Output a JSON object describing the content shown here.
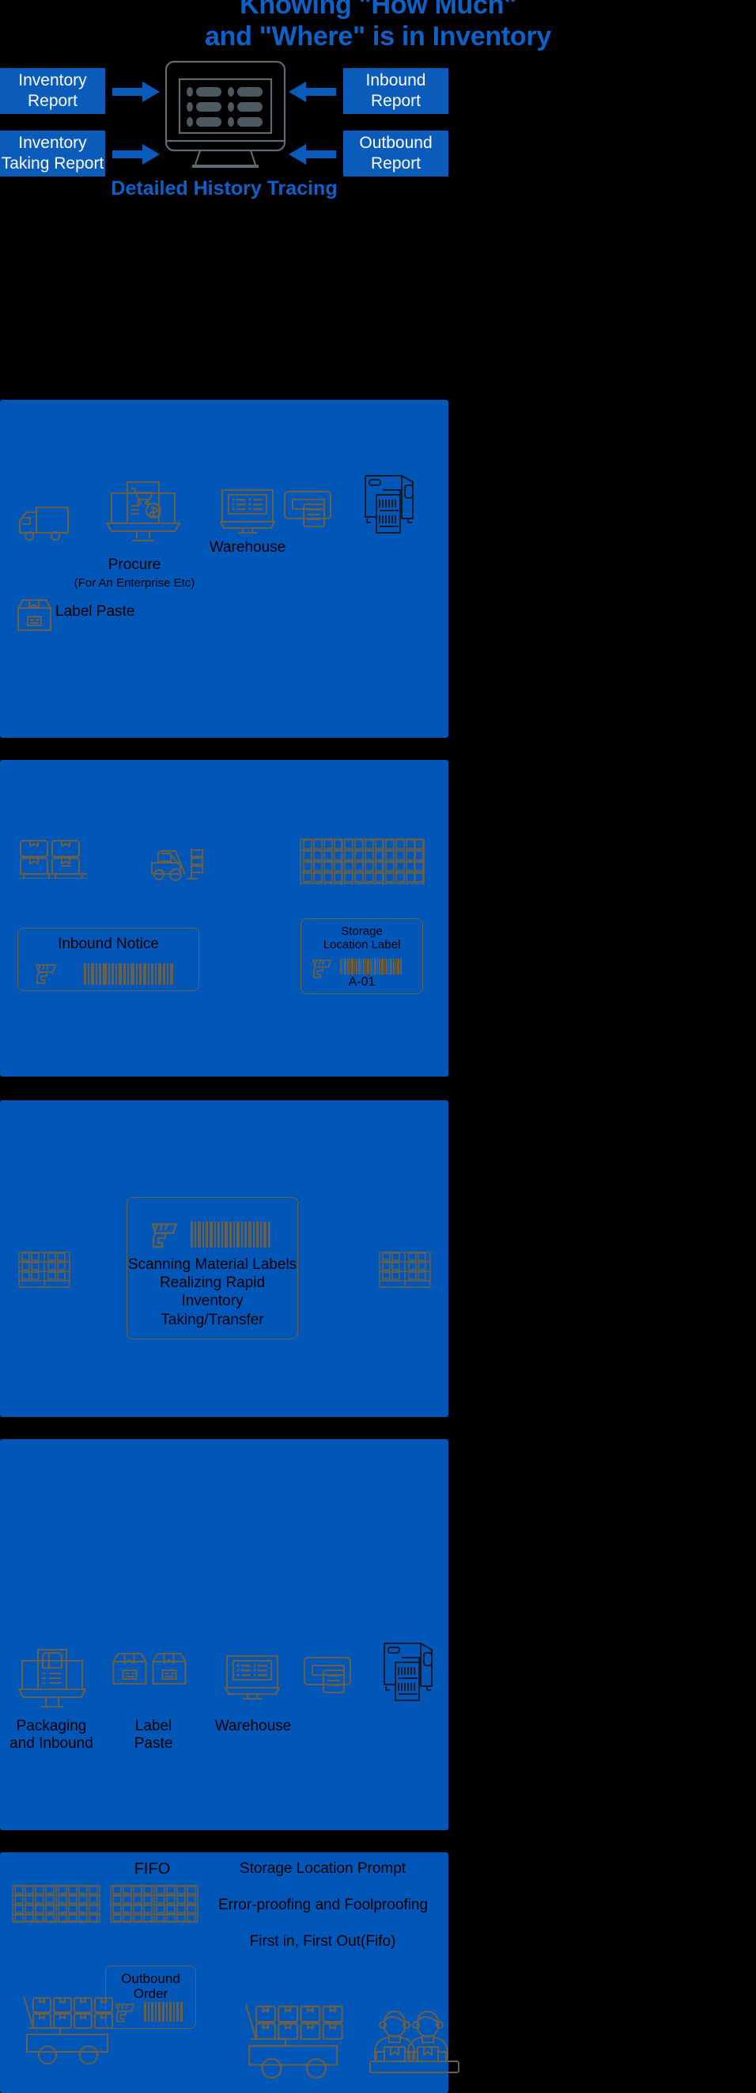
{
  "colors": {
    "background": "#000000",
    "panel_blue": "#0157b8",
    "box_blue": "#0a5bba",
    "title_blue": "#0d62c9",
    "icon_brown": "#6b6047",
    "text_black": "#000000",
    "text_white": "#ffffff"
  },
  "hero": {
    "title": "Knowing \"How Much\"\nand \"Where\" is in Inventory",
    "tracing_label": "Detailed History Tracing",
    "boxes": {
      "inventory_report": "Inventory\nReport",
      "inventory_taking_report": "Inventory\nTaking Report",
      "inbound_report": "Inbound\nReport",
      "outbound_report": "Outbound\nReport"
    },
    "icons": {
      "monitor": "monitor-icon",
      "arrow_right_1": "arrow-right-icon",
      "arrow_right_2": "arrow-right-icon",
      "arrow_left_1": "arrow-left-icon",
      "arrow_left_2": "arrow-left-icon"
    }
  },
  "section_procure": {
    "captions": {
      "procure": "Procure",
      "procure_sub": "(For An Enterprise Etc)",
      "warehouse": "Warehouse",
      "label_paste": "Label Paste"
    },
    "icons": {
      "truck": "delivery-truck-icon",
      "procure_monitor": "shopping-cart-monitor-icon",
      "warehouse_monitor": "monitor-list-icon",
      "printer": "printer-icon",
      "label_printer": "label-printer-icon",
      "carton_box": "carton-box-icon"
    }
  },
  "section_inbound": {
    "inbound_notice": {
      "title": "Inbound Notice",
      "icons": {
        "scanner": "barcode-scanner-icon",
        "barcode": "barcode-icon"
      }
    },
    "storage_location_label": {
      "title": "Storage\nLocation Label",
      "code": "A-01",
      "icons": {
        "scanner": "barcode-scanner-icon",
        "barcode": "barcode-icon"
      }
    },
    "icons": {
      "pallet_boxes": "pallet-boxes-icon",
      "forklift": "forklift-icon",
      "warehouse_rack": "warehouse-rack-icon"
    }
  },
  "section_scanning": {
    "card": {
      "title": "Scanning Material Labels\nRealizing Rapid Inventory\nTaking/Transfer",
      "icons": {
        "scanner": "barcode-scanner-icon",
        "barcode": "barcode-icon"
      }
    },
    "icons": {
      "rack_left": "warehouse-rack-icon",
      "rack_right": "warehouse-rack-icon"
    }
  },
  "section_packaging": {
    "captions": {
      "packaging_and_inbound": "Packaging\nand Inbound",
      "label_paste": "Label\nPaste",
      "warehouse": "Warehouse"
    },
    "icons": {
      "packaging_monitor": "packaging-monitor-icon",
      "carton_box_1": "carton-box-icon",
      "carton_box_2": "carton-box-icon",
      "warehouse_monitor": "monitor-list-icon",
      "printer": "printer-icon",
      "label_printer": "label-printer-icon"
    }
  },
  "section_fifo": {
    "fifo_label": "FIFO",
    "lines": [
      "Storage Location Prompt",
      "Error-proofing and Foolproofing",
      "First in, First Out(Fifo)"
    ],
    "outbound_order": {
      "title": "Outbound\nOrder",
      "icons": {
        "scanner": "barcode-scanner-icon",
        "barcode": "barcode-icon"
      }
    },
    "icons": {
      "rack_left": "warehouse-rack-icon",
      "rack_right": "warehouse-rack-icon",
      "cart_left": "hand-cart-icon",
      "cart_right": "hand-cart-icon",
      "workers": "workers-icon"
    }
  }
}
